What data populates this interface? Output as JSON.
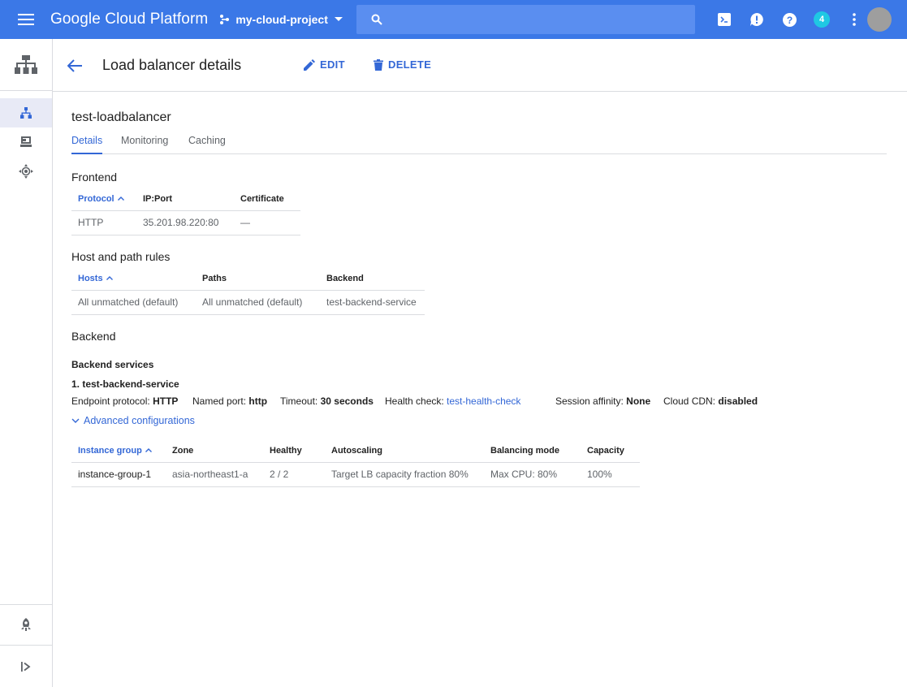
{
  "topbar": {
    "brand": "Google Cloud Platform",
    "project": "my-cloud-project",
    "search_placeholder": "",
    "notification_count": "4",
    "accent_color": "#3b78e7"
  },
  "header": {
    "title": "Load balancer details",
    "edit_label": "EDIT",
    "delete_label": "DELETE"
  },
  "lb": {
    "name": "test-loadbalancer",
    "tabs": [
      "Details",
      "Monitoring",
      "Caching"
    ],
    "active_tab": "Details"
  },
  "frontend": {
    "title": "Frontend",
    "columns": [
      "Protocol",
      "IP:Port",
      "Certificate"
    ],
    "rows": [
      [
        "HTTP",
        "35.201.98.220:80",
        "—"
      ]
    ]
  },
  "host_rules": {
    "title": "Host and path rules",
    "columns": [
      "Hosts",
      "Paths",
      "Backend"
    ],
    "rows": [
      [
        "All unmatched (default)",
        "All unmatched (default)",
        "test-backend-service"
      ]
    ]
  },
  "backend": {
    "title": "Backend",
    "services_label": "Backend services",
    "service_name": "1. test-backend-service",
    "endpoint_protocol_label": "Endpoint protocol:",
    "endpoint_protocol": "HTTP",
    "named_port_label": "Named port:",
    "named_port": "http",
    "timeout_label": "Timeout:",
    "timeout": "30 seconds",
    "health_check_label": "Health check:",
    "health_check": "test-health-check",
    "session_affinity_label": "Session affinity:",
    "session_affinity": "None",
    "cdn_label": "Cloud CDN:",
    "cdn": "disabled",
    "advanced_label": "Advanced configurations",
    "columns": [
      "Instance group",
      "Zone",
      "Healthy",
      "Autoscaling",
      "Balancing mode",
      "Capacity"
    ],
    "rows": [
      [
        "instance-group-1",
        "asia-northeast1-a",
        "2 / 2",
        "Target LB capacity fraction 80%",
        "Max CPU: 80%",
        "100%"
      ]
    ]
  },
  "icons": {
    "menu": "hamburger-menu-icon",
    "project": "project-hierarchy-icon",
    "search": "search-icon",
    "shell": "cloud-shell-icon",
    "alert": "alert-icon",
    "help": "help-icon",
    "nav_head": "network-services-icon",
    "nav_lb": "load-balancing-icon",
    "nav_cdn": "cloud-cdn-icon",
    "nav_dns": "cloud-dns-icon",
    "nav_marketplace": "marketplace-icon",
    "nav_expand": "expand-nav-icon"
  }
}
